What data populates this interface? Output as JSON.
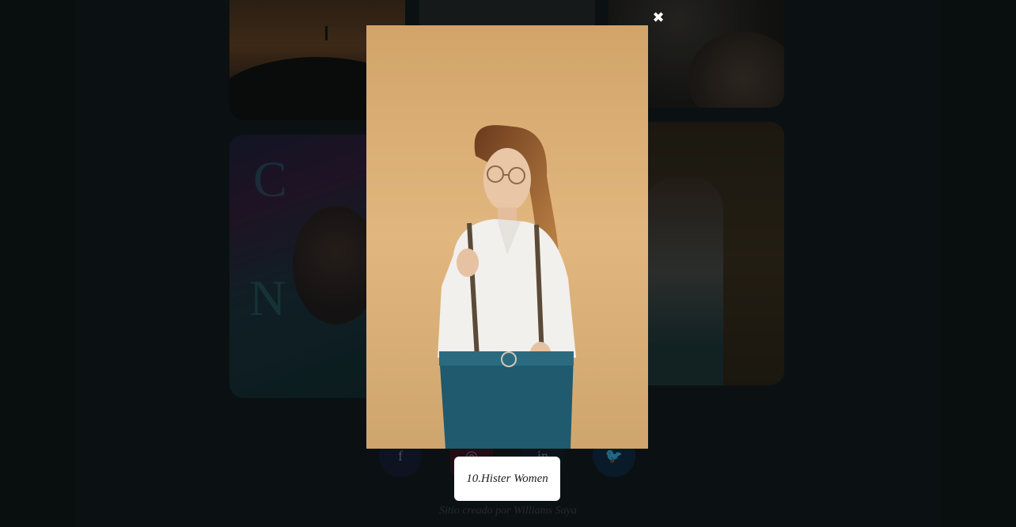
{
  "lightbox": {
    "caption": "10.Hister Women",
    "close_icon": "close-icon"
  },
  "social": [
    {
      "name": "facebook-icon",
      "glyph": "f"
    },
    {
      "name": "instagram-icon",
      "glyph": "◎"
    },
    {
      "name": "linkedin-icon",
      "glyph": "in"
    },
    {
      "name": "twitter-icon",
      "glyph": "🐦"
    }
  ],
  "footer": {
    "credit": "Sitio creado por Williams Saya"
  },
  "colors": {
    "overlay": "#0f1718",
    "caption_bg": "#ffffff",
    "photo_bg": "#d7ae74"
  }
}
